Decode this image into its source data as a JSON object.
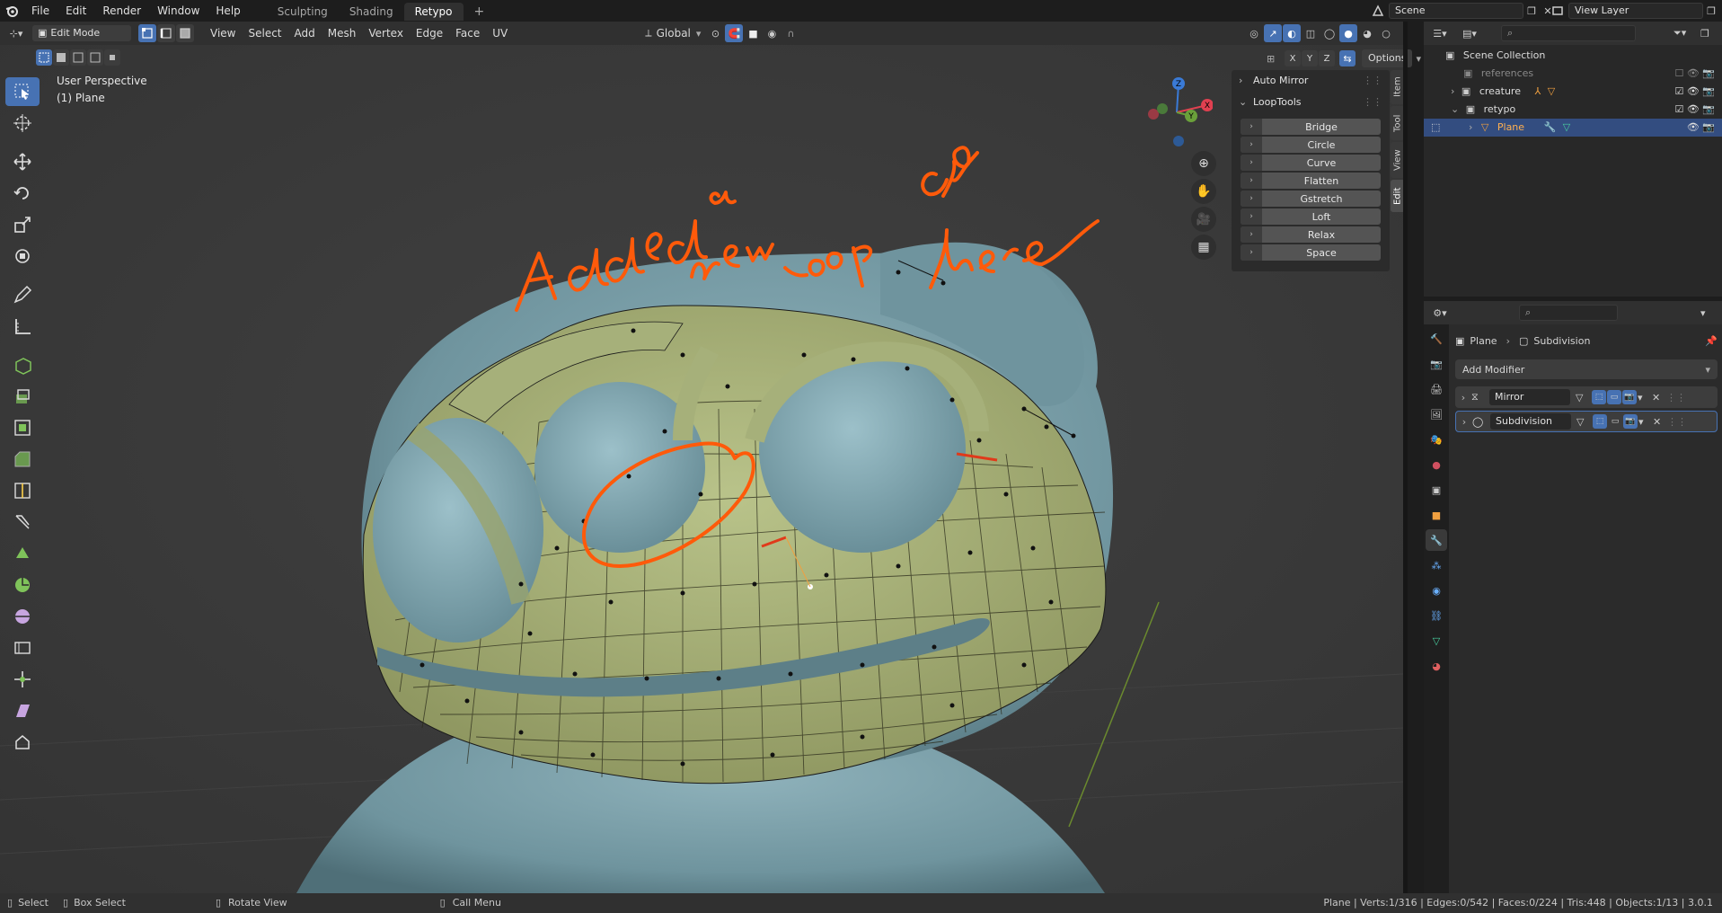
{
  "menu": {
    "items": [
      "File",
      "Edit",
      "Render",
      "Window",
      "Help"
    ],
    "workspaces": [
      "Sculpting",
      "Shading",
      "Retypo"
    ],
    "active_workspace": "Retypo",
    "add_tab": "+",
    "scene_name": "Scene",
    "view_layer": "View Layer"
  },
  "viewport_header": {
    "mode": "Edit Mode",
    "menus": [
      "View",
      "Select",
      "Add",
      "Mesh",
      "Vertex",
      "Edge",
      "Face",
      "UV"
    ],
    "orientation": "Global",
    "axes": [
      "X",
      "Y",
      "Z"
    ],
    "options": "Options"
  },
  "viewport": {
    "perspective": "User Perspective",
    "object": "(1) Plane",
    "annotation": {
      "color": "#ff5a0a"
    }
  },
  "npanel": {
    "tabs": [
      "Item",
      "Tool",
      "View",
      "Edit"
    ],
    "active_tab": "Edit",
    "auto_mirror": "Auto Mirror",
    "looptools": "LoopTools",
    "buttons": [
      "Bridge",
      "Circle",
      "Curve",
      "Flatten",
      "Gstretch",
      "Loft",
      "Relax",
      "Space"
    ]
  },
  "outliner": {
    "root": "Scene Collection",
    "rows": [
      {
        "name": "references",
        "dim": true
      },
      {
        "name": "creature",
        "dim": false
      },
      {
        "name": "retypo",
        "dim": false
      },
      {
        "name": "Plane",
        "selected": true
      }
    ]
  },
  "properties": {
    "breadcrumb": [
      "Plane",
      "Subdivision"
    ],
    "add_modifier": "Add Modifier",
    "modifiers": [
      "Mirror",
      "Subdivision"
    ]
  },
  "statusbar": {
    "select": "Select",
    "box_select": "Box Select",
    "rotate": "Rotate View",
    "call_menu": "Call Menu",
    "stats": "Plane | Verts:1/316 | Edges:0/542 | Faces:0/224 | Tris:448 | Objects:1/13 | 3.0.1"
  },
  "colors": {
    "accent": "#4772b3",
    "mesh": "#a6b07a",
    "body": "#7fa3ad",
    "selection_highlight": "#e05a2a"
  }
}
